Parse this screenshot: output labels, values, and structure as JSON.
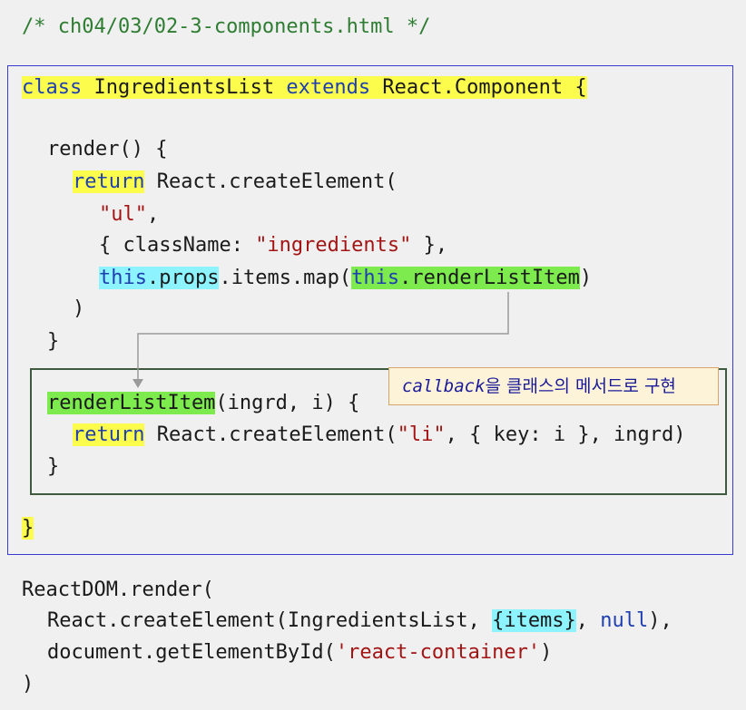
{
  "header_comment": "/* ch04/03/02-3-components.html */",
  "class_decl": {
    "kw_class": "class",
    "name": "IngredientsList",
    "kw_extends": "extends",
    "parent": "React.Component {"
  },
  "render_method": {
    "signature": "render() {",
    "kw_return": "return",
    "call": "React.createElement(",
    "arg_tag": "\"ul\"",
    "arg_props_pre": "{ className: ",
    "arg_props_val": "\"ingredients\"",
    "arg_props_post": " },",
    "this_kw": "this",
    "props": ".props",
    "map_call": ".items.map(",
    "arg_callback": "this.renderListItem",
    "map_close": ")",
    "close_paren": ")",
    "close_brace": "}"
  },
  "render_list_item": {
    "name": "renderListItem",
    "params": "(ingrd, i) {",
    "kw_return": "return",
    "call_pre": "React.createElement(",
    "tag": "\"li\"",
    "rest": ", { key: i }, ingrd)",
    "close_brace": "}"
  },
  "class_close": "}",
  "callout": {
    "term": "callback",
    "text": "을 클래스의 메서드로 구현"
  },
  "reactdom": {
    "line1": "ReactDOM.render(",
    "line2_pre": "React.createElement(IngredientsList, ",
    "line2_items": "{items}",
    "line2_comma": ", ",
    "line2_null": "null",
    "line2_post": "),",
    "line3_pre": "document.getElementById(",
    "line3_str": "'react-container'",
    "line3_post": ")",
    "line4": ")"
  }
}
